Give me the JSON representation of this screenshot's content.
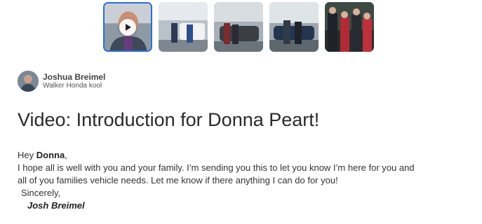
{
  "thumbnails": [
    {
      "id": "video",
      "is_video": true,
      "selected": true,
      "icon": "play-icon"
    },
    {
      "id": "photo-1",
      "is_video": false,
      "selected": false
    },
    {
      "id": "photo-2",
      "is_video": false,
      "selected": false
    },
    {
      "id": "photo-3",
      "is_video": false,
      "selected": false
    },
    {
      "id": "photo-4",
      "is_video": false,
      "selected": false
    }
  ],
  "author": {
    "name": "Joshua Breimel",
    "subtitle": "Walker Honda kool"
  },
  "title": "Video: Introduction for Donna Peart!",
  "message": {
    "greeting_prefix": "Hey ",
    "greeting_name": "Donna",
    "greeting_suffix": ",",
    "line1": "I hope all is well with you and your family. I’m sending you this to let you know I’m here for you and",
    "line2": "all of you families vehicle needs. Let me know if there anything I can do for you!",
    "closing": "Sincerely,",
    "signature": "Josh Breimel"
  },
  "colors": {
    "selected_border": "#2b6fd6",
    "text": "#333333"
  }
}
